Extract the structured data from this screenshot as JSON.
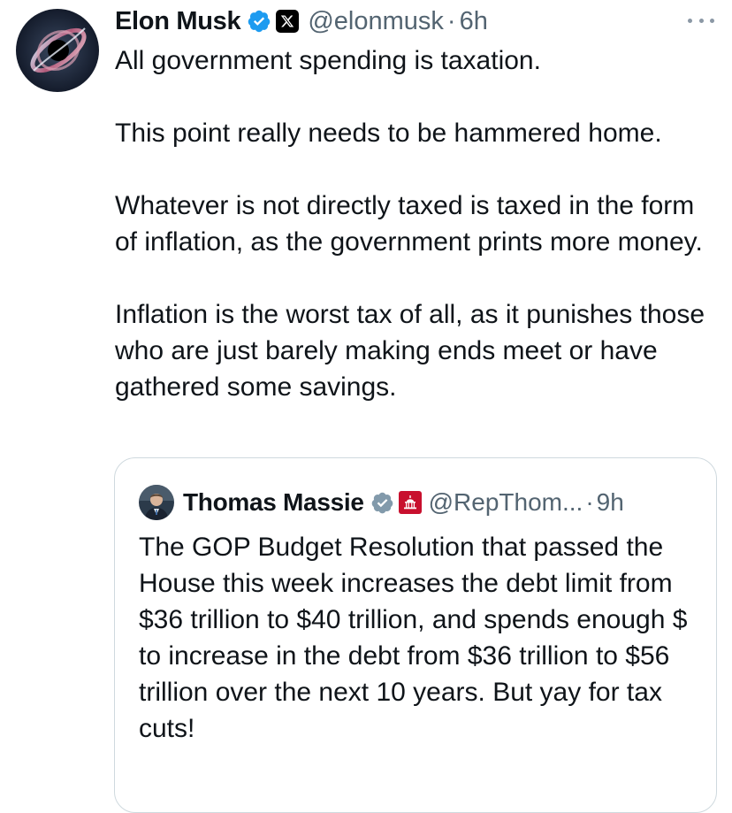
{
  "tweet": {
    "author_name": "Elon Musk",
    "handle": "@elonmusk",
    "separator": "·",
    "timestamp": "6h",
    "avatar_icon": "black-hole-avatar",
    "verified_icon": "verified-badge-icon",
    "affiliation_icon": "x-logo-icon",
    "more_icon": "more-options-icon",
    "paragraphs": [
      "All government spending is taxation.",
      "This point really needs to be hammered home.",
      "Whatever is not directly taxed is taxed in the form of inflation, as the government prints more money.",
      "Inflation is the worst tax of all, as it punishes those who are just barely making ends meet or have gathered some savings."
    ]
  },
  "quote": {
    "author_name": "Thomas Massie",
    "handle": "@RepThom...",
    "separator": "·",
    "timestamp": "9h",
    "avatar_icon": "person-avatar",
    "verified_icon": "verified-badge-gray-icon",
    "affiliation_icon": "us-capitol-badge-icon",
    "text": "The GOP Budget Resolution that passed the House this week increases the debt limit from $36 trillion to $40 trillion, and spends enough $ to increase in the debt from $36 trillion to $56 trillion over the next 10 years. But yay for tax cuts!"
  },
  "colors": {
    "text_primary": "#0f1419",
    "text_secondary": "#536471",
    "verified_blue": "#1d9bf0",
    "verified_gray": "#829aab",
    "border": "#cfd9de",
    "capitol_red": "#c8102e"
  }
}
